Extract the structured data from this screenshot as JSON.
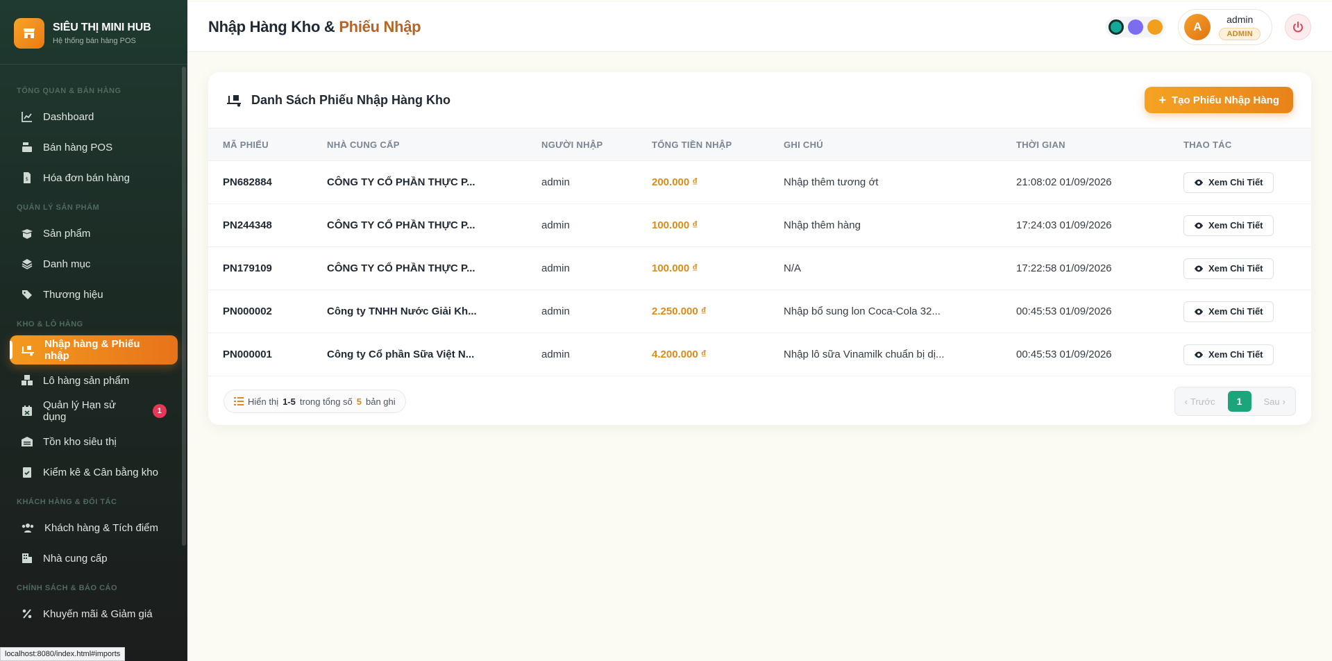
{
  "brand": {
    "name": "SIÊU THỊ MINI HUB",
    "subtitle": "Hệ thống bán hàng POS"
  },
  "sidebar": {
    "sections": [
      {
        "title": "TỔNG QUAN & BÁN HÀNG",
        "items": [
          {
            "label": "Dashboard",
            "icon": "chart-line-icon"
          },
          {
            "label": "Bán hàng POS",
            "icon": "cash-register-icon"
          },
          {
            "label": "Hóa đơn bán hàng",
            "icon": "invoice-icon"
          }
        ]
      },
      {
        "title": "QUẢN LÝ SẢN PHẨM",
        "items": [
          {
            "label": "Sản phẩm",
            "icon": "box-open-icon"
          },
          {
            "label": "Danh mục",
            "icon": "layers-icon"
          },
          {
            "label": "Thương hiệu",
            "icon": "tags-icon"
          }
        ]
      },
      {
        "title": "KHO & LÔ HÀNG",
        "items": [
          {
            "label": "Nhập hàng & Phiếu nhập",
            "icon": "truck-loading-icon",
            "active": true
          },
          {
            "label": "Lô hàng sản phẩm",
            "icon": "boxes-icon"
          },
          {
            "label": "Quản lý Hạn sử dụng",
            "icon": "calendar-x-icon",
            "badge": "1"
          },
          {
            "label": "Tồn kho siêu thị",
            "icon": "warehouse-icon"
          },
          {
            "label": "Kiểm kê & Cân bằng kho",
            "icon": "clipboard-check-icon"
          }
        ]
      },
      {
        "title": "KHÁCH HÀNG & ĐỐI TÁC",
        "items": [
          {
            "label": "Khách hàng & Tích điểm",
            "icon": "users-icon"
          },
          {
            "label": "Nhà cung cấp",
            "icon": "building-icon"
          }
        ]
      },
      {
        "title": "CHÍNH SÁCH & BÁO CÁO",
        "items": [
          {
            "label": "Khuyến mãi & Giảm giá",
            "icon": "percent-icon"
          }
        ]
      }
    ]
  },
  "status_url": "localhost:8080/index.html#imports",
  "header": {
    "title_main": "Nhập Hàng Kho",
    "title_sep": " & ",
    "title_accent": "Phiếu Nhập",
    "theme_colors": [
      "#15a89a",
      "#7b6cf0",
      "#f0a01c"
    ],
    "user": {
      "initial": "A",
      "name": "admin",
      "role": "ADMIN"
    }
  },
  "card": {
    "title": "Danh Sách Phiếu Nhập Hàng Kho",
    "create_label": "Tạo Phiếu Nhập Hàng",
    "columns": [
      "MÃ PHIẾU",
      "NHÀ CUNG CẤP",
      "NGƯỜI NHẬP",
      "TỔNG TIỀN NHẬP",
      "GHI CHÚ",
      "THỜI GIAN",
      "THAO TÁC"
    ],
    "rows": [
      {
        "code": "PN682884",
        "supplier": "CÔNG TY CỔ PHẦN THỰC P...",
        "user": "admin",
        "amount": "200.000 ₫",
        "note": "Nhập thêm tương ớt",
        "time": "21:08:02 01/09/2026",
        "action": "Xem Chi Tiết"
      },
      {
        "code": "PN244348",
        "supplier": "CÔNG TY CỔ PHẦN THỰC P...",
        "user": "admin",
        "amount": "100.000 ₫",
        "note": "Nhập thêm hàng",
        "time": "17:24:03 01/09/2026",
        "action": "Xem Chi Tiết"
      },
      {
        "code": "PN179109",
        "supplier": "CÔNG TY CỔ PHẦN THỰC P...",
        "user": "admin",
        "amount": "100.000 ₫",
        "note": "N/A",
        "time": "17:22:58 01/09/2026",
        "action": "Xem Chi Tiết"
      },
      {
        "code": "PN000002",
        "supplier": "Công ty TNHH Nước Giải Kh...",
        "user": "admin",
        "amount": "2.250.000 ₫",
        "note": "Nhập bổ sung lon Coca-Cola 32...",
        "time": "00:45:53 01/09/2026",
        "action": "Xem Chi Tiết"
      },
      {
        "code": "PN000001",
        "supplier": "Công ty Cổ phần Sữa Việt N...",
        "user": "admin",
        "amount": "4.200.000 ₫",
        "note": "Nhập lô sữa Vinamilk chuẩn bị dị...",
        "time": "00:45:53 01/09/2026",
        "action": "Xem Chi Tiết"
      }
    ],
    "footer": {
      "show_label": "Hiển thị",
      "range": "1-5",
      "of_label": "trong tổng số",
      "total": "5",
      "records_label": "bản ghi",
      "prev_label": "Trước",
      "next_label": "Sau",
      "current_page": "1"
    }
  }
}
